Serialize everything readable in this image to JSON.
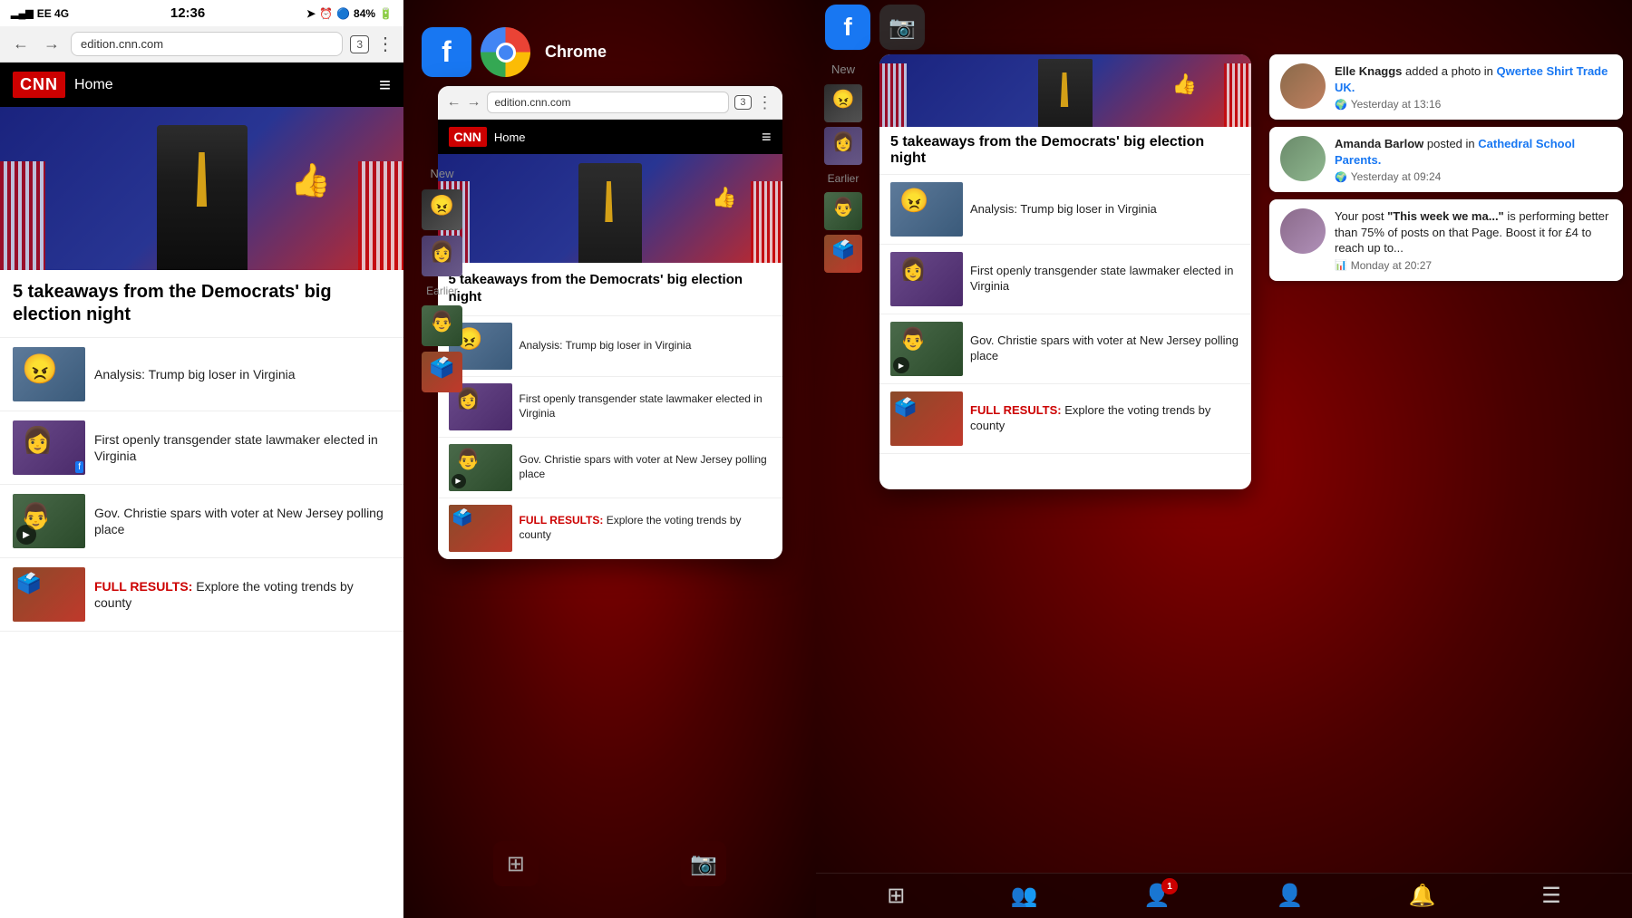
{
  "left": {
    "status": {
      "carrier": "EE 4G",
      "time": "12:36",
      "battery": "84%"
    },
    "browser": {
      "url": "edition.cnn.com",
      "tab_count": "3"
    },
    "cnn_header": {
      "logo": "CNN",
      "home": "Home"
    },
    "hero_headline": "5 takeaways from the Democrats' big election night",
    "news_items": [
      {
        "text": "Analysis: Trump big loser in Virginia"
      },
      {
        "text": "First openly transgender state lawmaker elected in Virginia"
      },
      {
        "text": "Gov. Christie spars with voter at New Jersey polling place"
      },
      {
        "text_prefix": "FULL RESULTS:",
        "text_suffix": " Explore the voting trends by county"
      }
    ]
  },
  "center": {
    "app_labels": {
      "chrome": "Chrome"
    },
    "browser": {
      "url": "edition.cnn.com",
      "tab_count": "3"
    },
    "cnn_header": {
      "logo": "CNN",
      "home": "Home"
    },
    "hero_headline": "5 takeaways from the Democrats' big election night",
    "news_items": [
      {
        "text": "Analysis: Trump big loser in Virginia"
      },
      {
        "text": "First openly transgender state lawmaker elected in Virginia"
      },
      {
        "text": "Gov. Christie spars with voter at New Jersey polling place"
      },
      {
        "text_prefix": "FULL RESULTS:",
        "text_suffix": " Explore the voting trends by county"
      }
    ],
    "sidebar_labels": {
      "new": "New",
      "earlier": "Earlier"
    }
  },
  "right": {
    "cnn_card": {
      "hero_headline": "5 takeaways from the Democrats' big election night",
      "news_items": [
        {
          "text": "Analysis: Trump big loser in Virginia"
        },
        {
          "text": "First openly transgender state lawmaker elected in Virginia"
        },
        {
          "text": "Gov. Christie spars with voter at New Jersey polling place"
        },
        {
          "text_prefix": "FULL RESULTS:",
          "text_suffix": " Explore the voting trends by county"
        }
      ]
    },
    "sidebar_labels": {
      "new": "New",
      "earlier": "Earlier"
    },
    "notifications": [
      {
        "user": "Elle Knaggs",
        "action": "added a photo in",
        "target": "Qwertee Shirt Trade UK.",
        "time": "Yesterday at 13:16",
        "has_fb_icon": true
      },
      {
        "user": "Amanda Barlow",
        "action": "posted in",
        "target": "Cathedral School Parents.",
        "time": "Yesterday at 09:24",
        "has_fb_icon": true
      },
      {
        "user": "Your post",
        "action": "\"This week we ma...\" is performing better than 75% of posts on that Page. Boost it for £4 to reach up to...",
        "target": "",
        "time": "Monday at 20:27",
        "has_chart_icon": true
      }
    ],
    "bottom_bar": {
      "icons": [
        "⊞",
        "👥",
        "🔔",
        "👤",
        "🔔",
        "☰"
      ],
      "notif_badge": "1"
    }
  }
}
